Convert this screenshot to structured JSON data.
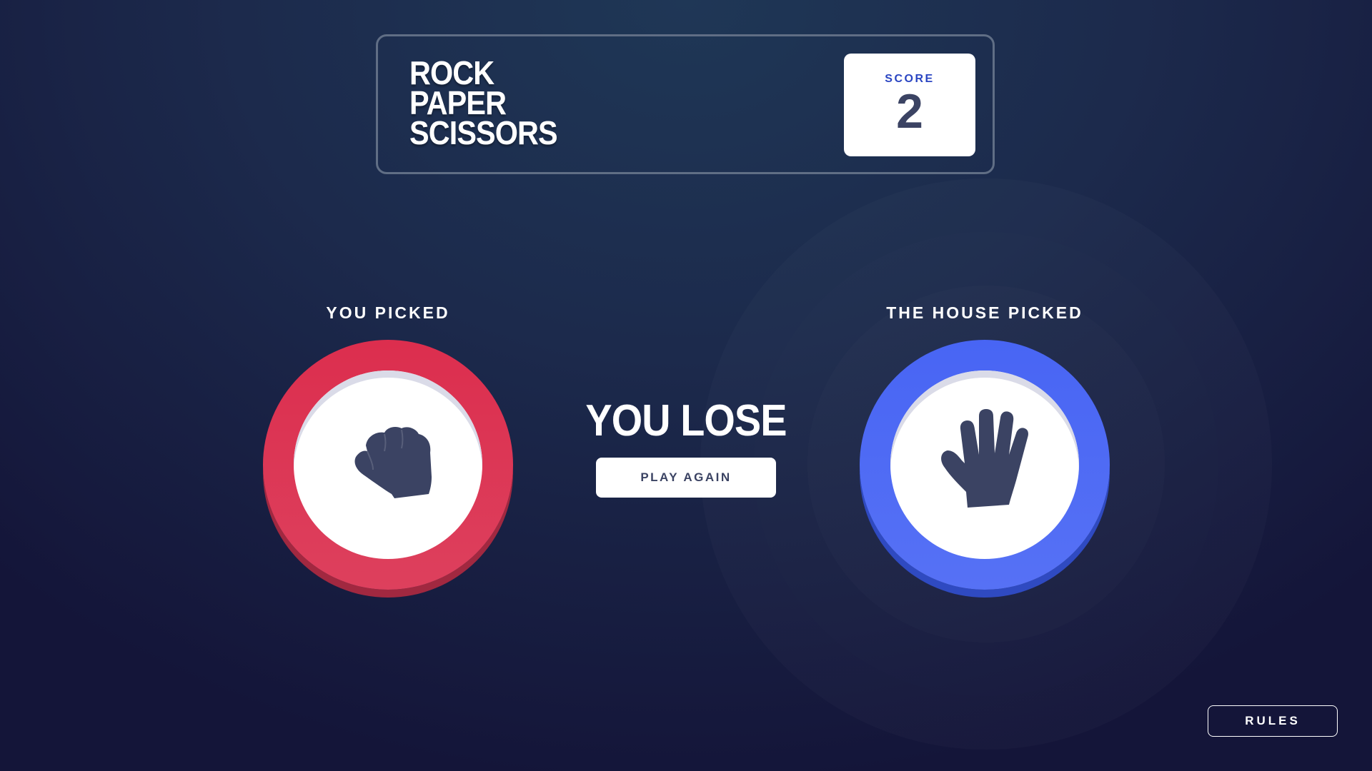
{
  "header": {
    "title_lines": [
      "ROCK",
      "PAPER",
      "SCISSORS"
    ],
    "score_label": "SCORE",
    "score_value": "2"
  },
  "game": {
    "player_label": "YOU PICKED",
    "house_label": "THE HOUSE PICKED",
    "player_choice": {
      "name": "rock",
      "icon": "rock-fist-icon",
      "color": "#dc2e4e"
    },
    "house_choice": {
      "name": "paper",
      "icon": "paper-hand-icon",
      "color": "#4865f4"
    },
    "result_text": "YOU LOSE",
    "play_again_label": "PLAY AGAIN"
  },
  "footer": {
    "rules_label": "RULES"
  },
  "colors": {
    "background_dark": "#141539",
    "background_light": "#1f3756",
    "header_outline": "#606e85",
    "score_text": "#2a45c2",
    "dark_text": "#3b4363"
  }
}
